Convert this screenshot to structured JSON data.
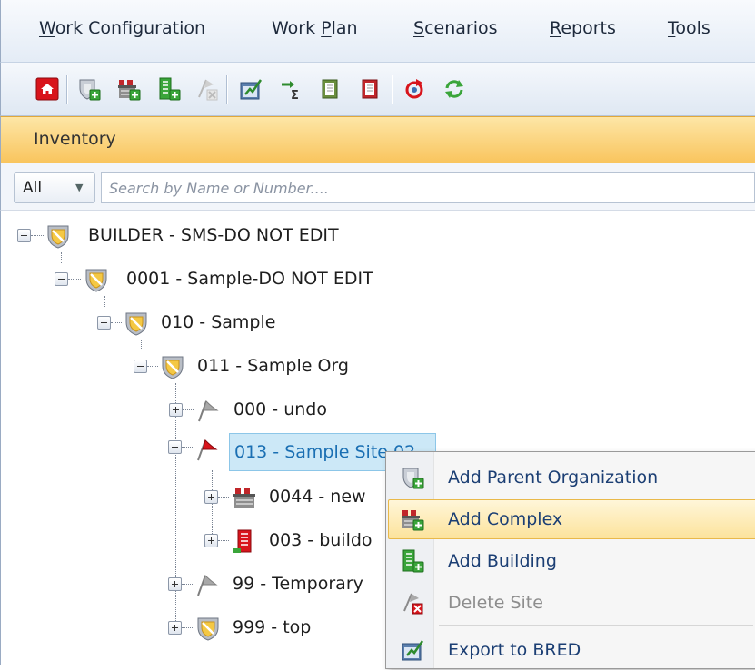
{
  "menubar": {
    "items": [
      {
        "pre": "",
        "key": "W",
        "post": "ork Configuration"
      },
      {
        "pre": "Work ",
        "key": "P",
        "post": "lan"
      },
      {
        "pre": "",
        "key": "S",
        "post": "cenarios"
      },
      {
        "pre": "",
        "key": "R",
        "post": "eports"
      },
      {
        "pre": "",
        "key": "T",
        "post": "ools"
      }
    ]
  },
  "toolbar": {
    "buttons": [
      "home-icon",
      "add-organization-icon",
      "add-complex-icon",
      "add-building-icon",
      "delete-site-icon",
      "export-icon",
      "sum-icon",
      "book-icon",
      "red-book-icon",
      "refresh-icon",
      "sync-icon"
    ]
  },
  "inventory": {
    "title": "Inventory",
    "filter_value": "All",
    "search_placeholder": "Search by Name or Number...."
  },
  "tree": {
    "nodes": [
      {
        "label": "BUILDER - SMS-DO NOT EDIT",
        "icon": "shield-icon",
        "expanded": true
      },
      {
        "label": "0001 - Sample-DO NOT EDIT",
        "icon": "shield-icon",
        "expanded": true
      },
      {
        "label": "010 - Sample",
        "icon": "shield-icon",
        "expanded": true
      },
      {
        "label": "011 - Sample Org",
        "icon": "shield-icon",
        "expanded": true
      },
      {
        "label": "000 - undo",
        "icon": "grey-flag-icon",
        "expanded": false
      },
      {
        "label": "013 - Sample Site 02",
        "icon": "red-flag-icon",
        "expanded": true,
        "selected": true
      },
      {
        "label": "0044 - new",
        "icon": "complex-icon",
        "expanded": false
      },
      {
        "label": "003 - buildo",
        "icon": "building-icon",
        "expanded": false
      },
      {
        "label": "99 - Temporary",
        "icon": "grey-flag-icon",
        "expanded": false
      },
      {
        "label": "999 - top",
        "icon": "shield-icon",
        "expanded": false
      }
    ]
  },
  "context_menu": {
    "items": [
      {
        "label": "Add Parent Organization",
        "icon": "add-organization-icon",
        "enabled": true
      },
      {
        "label": "Add Complex",
        "icon": "add-complex-icon",
        "enabled": true,
        "hovered": true
      },
      {
        "label": "Add Building",
        "icon": "add-building-icon",
        "enabled": true
      },
      {
        "label": "Delete Site",
        "icon": "delete-site-icon",
        "enabled": false
      },
      {
        "label": "Export to BRED",
        "icon": "export-icon",
        "enabled": true
      }
    ]
  },
  "colors": {
    "header_orange": "#f9c55e",
    "selection_blue": "#cce8f7",
    "menu_text": "#1c3f74",
    "hover_yellow": "#fce39c"
  }
}
